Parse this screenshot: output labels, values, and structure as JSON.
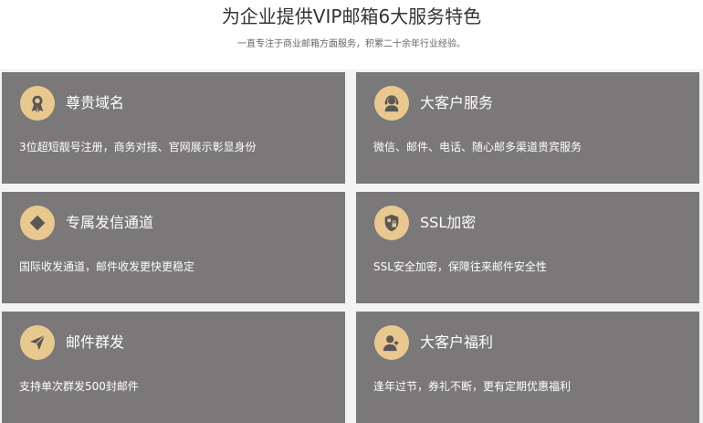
{
  "header": {
    "title": "为企业提供VIP邮箱6大服务特色",
    "subtitle": "一直专注于商业邮箱方面服务，积累二十余年行业经验。"
  },
  "colors": {
    "card_bg": "#7a7878",
    "icon_bg": "#e8c88f",
    "icon_fg": "#5a5656",
    "text": "#ffffff"
  },
  "cards": [
    {
      "icon": "ribbon-award-icon",
      "title": "尊贵域名",
      "desc": "3位超短靓号注册，商务对接、官网展示彰显身份"
    },
    {
      "icon": "headset-agent-icon",
      "title": "大客户服务",
      "desc": "微信、邮件、电话、随心邮多渠道贵宾服务"
    },
    {
      "icon": "diamond-icon",
      "title": "专属发信通道",
      "desc": "国际收发通道，邮件收发更快更稳定"
    },
    {
      "icon": "shield-lock-icon",
      "title": "SSL加密",
      "desc": "SSL安全加密，保障往来邮件安全性"
    },
    {
      "icon": "paper-plane-icon",
      "title": "邮件群发",
      "desc": "支持单次群发500封邮件"
    },
    {
      "icon": "vip-user-icon",
      "title": "大客户福利",
      "desc": "逢年过节，券礼不断，更有定期优惠福利"
    }
  ]
}
